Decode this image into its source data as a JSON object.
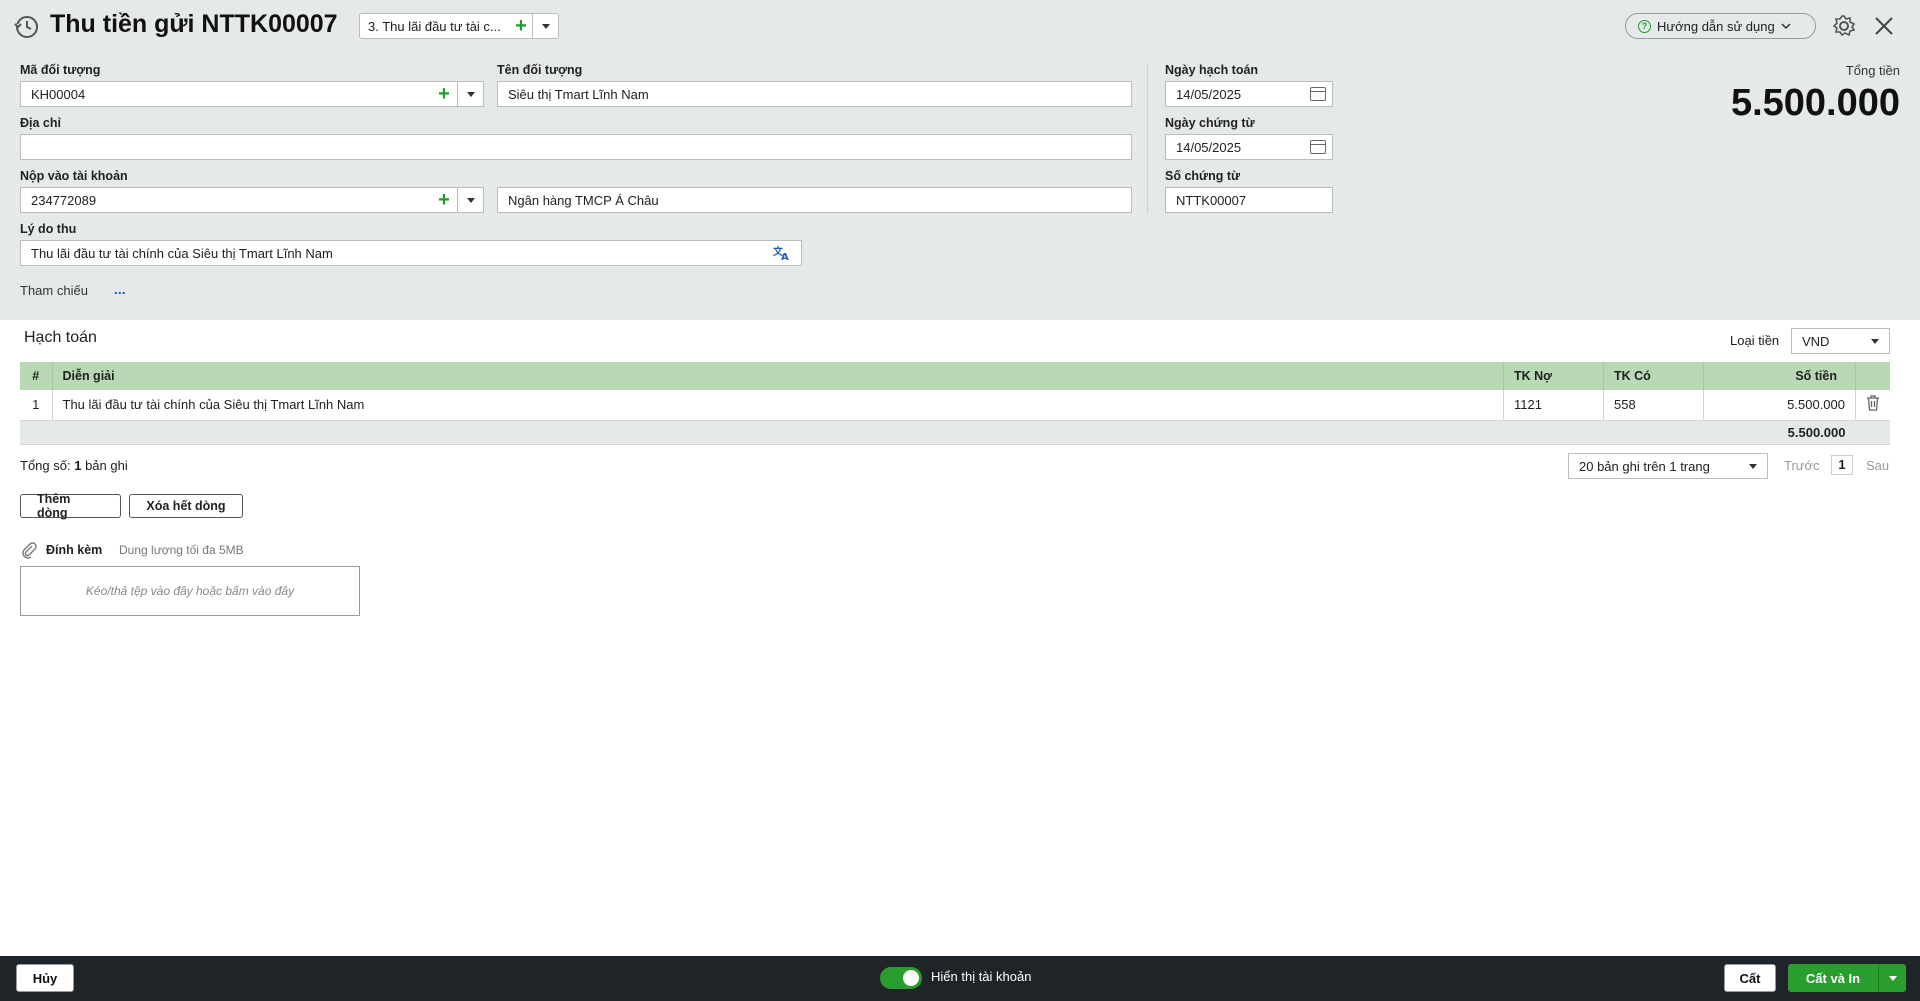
{
  "header": {
    "title": "Thu tiền gửi NTTK00007",
    "voucher_type": "3. Thu lãi đầu tư tài c...",
    "help_label": "Hướng dẫn sử dụng"
  },
  "form": {
    "ma_doi_tuong_label": "Mã đối tượng",
    "ma_doi_tuong_value": "KH00004",
    "ten_doi_tuong_label": "Tên đối tượng",
    "ten_doi_tuong_value": "Siêu thị Tmart Lĩnh Nam",
    "dia_chi_label": "Địa chỉ",
    "dia_chi_value": "",
    "nop_vao_label": "Nộp vào tài khoản",
    "nop_vao_value": "234772089",
    "ngan_hang_value": "Ngân hàng TMCP Á Châu",
    "ly_do_label": "Lý do thu",
    "ly_do_value": "Thu lãi đầu tư tài chính của Siêu thị Tmart Lĩnh Nam",
    "tham_chieu_label": "Tham chiếu",
    "tham_chieu_more": "...",
    "ngay_hach_toan_label": "Ngày hạch toán",
    "ngay_hach_toan_value": "14/05/2025",
    "ngay_chung_tu_label": "Ngày chứng từ",
    "ngay_chung_tu_value": "14/05/2025",
    "so_chung_tu_label": "Số chứng từ",
    "so_chung_tu_value": "NTTK00007",
    "tong_tien_label": "Tổng tiền",
    "tong_tien_value": "5.500.000"
  },
  "accounting": {
    "section_title": "Hạch toán",
    "currency_label": "Loại tiền",
    "currency_value": "VND",
    "columns": [
      "#",
      "Diễn giải",
      "TK Nợ",
      "TK Có",
      "Số tiền"
    ],
    "rows": [
      {
        "no": "1",
        "dien_giai": "Thu lãi đầu tư tài chính của Siêu thị Tmart Lĩnh Nam",
        "tk_no": "1121",
        "tk_co": "558",
        "so_tien": "5.500.000"
      }
    ],
    "sum_value": "5.500.000",
    "total_prefix": "Tổng số:",
    "total_count": "1",
    "total_suffix": "bản ghi",
    "page_size_option": "20 bản ghi trên 1 trang",
    "prev_label": "Trước",
    "current_page": "1",
    "next_label": "Sau",
    "add_row_label": "Thêm dòng",
    "delete_all_label": "Xóa hết dòng"
  },
  "attachment": {
    "label": "Đính kèm",
    "hint": "Dung lượng tối đa 5MB",
    "dropzone_text": "Kéo/thả tệp vào đây hoặc bấm vào đây"
  },
  "footer": {
    "cancel_label": "Hủy",
    "toggle_label": "Hiển thị tài khoản",
    "save_label": "Cất",
    "save_print_label": "Cất và In"
  },
  "colors": {
    "accent_green": "#2a9d2f",
    "grid_header": "#b9d9b5",
    "top_bg": "#e6e9ea",
    "footer_bg": "#1e2427"
  }
}
